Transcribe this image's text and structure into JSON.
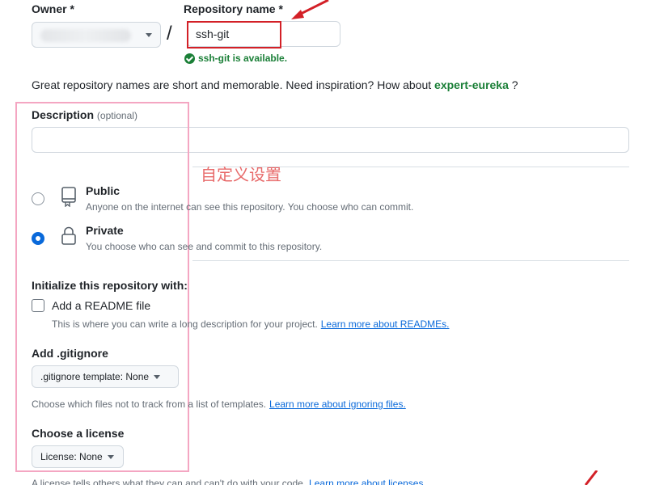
{
  "owner": {
    "label": "Owner *"
  },
  "repo": {
    "label": "Repository name *",
    "value": "ssh-git",
    "availability": "ssh-git is available."
  },
  "separator": "/",
  "hint": {
    "text": "Great repository names are short and memorable. Need inspiration? How about",
    "suggestion": "expert-eureka",
    "suffix": "?"
  },
  "description": {
    "label": "Description",
    "optional": "(optional)",
    "value": ""
  },
  "annotation": "自定义设置",
  "visibility": {
    "public": {
      "title": "Public",
      "desc": "Anyone on the internet can see this repository. You choose who can commit."
    },
    "private": {
      "title": "Private",
      "desc": "You choose who can see and commit to this repository.",
      "selected": true
    }
  },
  "initialize": {
    "heading": "Initialize this repository with:",
    "readme": {
      "label": "Add a README file",
      "desc": "This is where you can write a long description for your project.",
      "link": "Learn more about READMEs."
    }
  },
  "gitignore": {
    "heading": "Add .gitignore",
    "button": ".gitignore template: None",
    "desc": "Choose which files not to track from a list of templates.",
    "link": "Learn more about ignoring files."
  },
  "license": {
    "heading": "Choose a license",
    "button": "License: None",
    "desc": "A license tells others what they can and can't do with your code.",
    "link": "Learn more about licenses."
  },
  "colors": {
    "accent": "#0969da",
    "success": "#1a7f37",
    "annotation_red": "#d32027",
    "annotation_pink": "#f4a6c2"
  }
}
